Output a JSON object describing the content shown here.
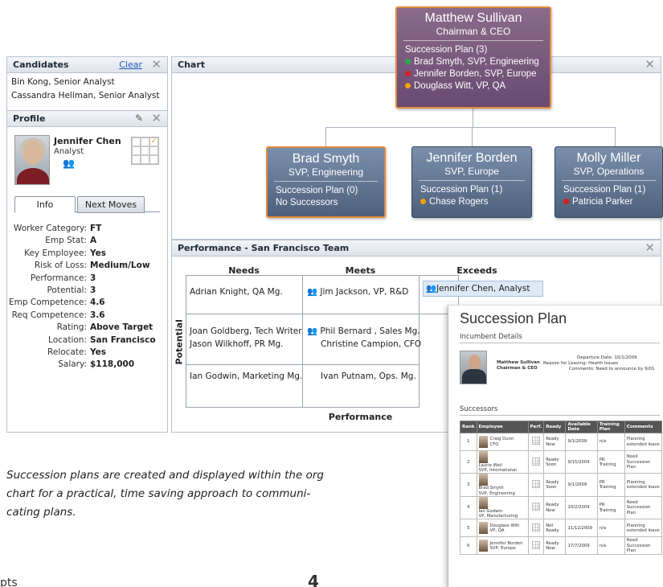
{
  "candidates": {
    "title": "Candidates",
    "clear_label": "Clear",
    "items": [
      "Bin Kong, Senior Analyst",
      "Cassandra Hellman, Senior Analyst"
    ]
  },
  "profile": {
    "title": "Profile",
    "name": "Jennifer Chen",
    "role": "Analyst",
    "tabs": [
      {
        "label": "Info"
      },
      {
        "label": "Next Moves"
      }
    ],
    "fields": [
      {
        "k": "Worker Category:",
        "v": "FT"
      },
      {
        "k": "Emp Stat:",
        "v": "A"
      },
      {
        "k": "Key Employee:",
        "v": "Yes"
      },
      {
        "k": "Risk of Loss:",
        "v": "Medium/Low"
      },
      {
        "k": "Performance:",
        "v": "3"
      },
      {
        "k": "Potential:",
        "v": "3"
      },
      {
        "k": "Emp Competence:",
        "v": "4.6"
      },
      {
        "k": "Req Competence:",
        "v": "3.6"
      },
      {
        "k": "Rating:",
        "v": "Above Target"
      },
      {
        "k": "Location:",
        "v": "San Francisco"
      },
      {
        "k": "Relocate:",
        "v": "Yes"
      },
      {
        "k": "Salary:",
        "v": "$118,000"
      }
    ]
  },
  "chart": {
    "title": "Chart",
    "ceo": {
      "name": "Matthew Sullivan",
      "title": "Chairman & CEO",
      "plan": "Succession Plan (3)",
      "successors": [
        {
          "text": "Brad Smyth, SVP, Engineering",
          "color": "#2fa84a"
        },
        {
          "text": "Jennifer Borden, SVP, Europe",
          "color": "#d42020"
        },
        {
          "text": "Douglass Witt, VP, QA",
          "color": "#f0a400"
        }
      ]
    },
    "reports": [
      {
        "name": "Brad Smyth",
        "title": "SVP, Engineering",
        "plan": "Succession Plan (0)",
        "line2": "No Successors",
        "dot": ""
      },
      {
        "name": "Jennifer Borden",
        "title": "SVP, Europe",
        "plan": "Succession Plan (1)",
        "line2": "Chase Rogers",
        "dot": "#f0a400"
      },
      {
        "name": "Molly Miller",
        "title": "SVP, Operations",
        "plan": "Succession Plan (1)",
        "line2": "Patricia Parker",
        "dot": "#d42020"
      }
    ]
  },
  "performance": {
    "title": "Performance - San Francisco Team",
    "columns": [
      "Needs",
      "Meets",
      "Exceeds"
    ],
    "row_axis": "Potential",
    "col_axis": "Performance",
    "cells": {
      "r1c1": [
        "Adrian Knight, QA Mg."
      ],
      "r1c2": [
        "Jim Jackson, VP, R&D"
      ],
      "r1c3": [
        "Jennifer Chen,  Analyst"
      ],
      "r2c1": [
        "Joan Goldberg, Tech Writer",
        "Jason Wilkhoff, PR Mg."
      ],
      "r2c2": [
        "Phil Bernard , Sales Mg.",
        "Christine Campion, CFO"
      ],
      "r3c1": [
        "Ian Godwin, Marketing Mg."
      ],
      "r3c2": [
        "Ivan Putnam, Ops. Mg."
      ]
    }
  },
  "succession_doc": {
    "title": "Succession Plan",
    "incumbent_label": "Incumbent Details",
    "incumbent_name": "Matthew Sullivan",
    "incumbent_title": "Chairman & CEO",
    "departure": "Departure Date: 10/1/2009",
    "reason": "Reason for Leaving: Health Issues",
    "comments": "Comments: Need to announce by 9/01",
    "successors_label": "Successors",
    "headers": [
      "Rank",
      "Employee",
      "Perf.",
      "Ready",
      "Available Date",
      "Training Plan",
      "Comments"
    ],
    "rows": [
      {
        "rank": "1",
        "name": "Craig Dunn",
        "role": "CFO",
        "ready": "Ready Now",
        "date": "9/1/2009",
        "training": "n/a",
        "comments": "Planning extended leave"
      },
      {
        "rank": "2",
        "name": "Laurie Weil",
        "role": "SVP, International",
        "ready": "Ready Soon",
        "date": "9/15/2009",
        "training": "PR Training",
        "comments": "Need Succession Plan"
      },
      {
        "rank": "3",
        "name": "Brad Smyth",
        "role": "SVP, Engineering",
        "ready": "Ready Soon",
        "date": "9/1/2009",
        "training": "PR Training",
        "comments": "Planning extended leave"
      },
      {
        "rank": "4",
        "name": "Ian Godwin",
        "role": "VP, Manufacturing",
        "ready": "Ready Now",
        "date": "10/2/2009",
        "training": "PR Training",
        "comments": "Need Succession Plan"
      },
      {
        "rank": "5",
        "name": "Douglass Witt",
        "role": "VP, QA",
        "ready": "Not Ready",
        "date": "11/12/2009",
        "training": "n/a",
        "comments": "Planning extended leave"
      },
      {
        "rank": "6",
        "name": "Jennifer Borden",
        "role": "SVP, Europe",
        "ready": "Ready Now",
        "date": "17/7/2009",
        "training": "n/a",
        "comments": "Need Succession Plan"
      }
    ]
  },
  "caption": "Succession plans are created and displayed within the org chart for a practical, time saving approach to communi-cating plans.",
  "caption_lines": [
    "Succession plans are created and displayed within the org",
    "chart for a practical, time saving approach to communi-",
    "cating plans."
  ],
  "footer_fragment": "pts",
  "footer_page": "4"
}
